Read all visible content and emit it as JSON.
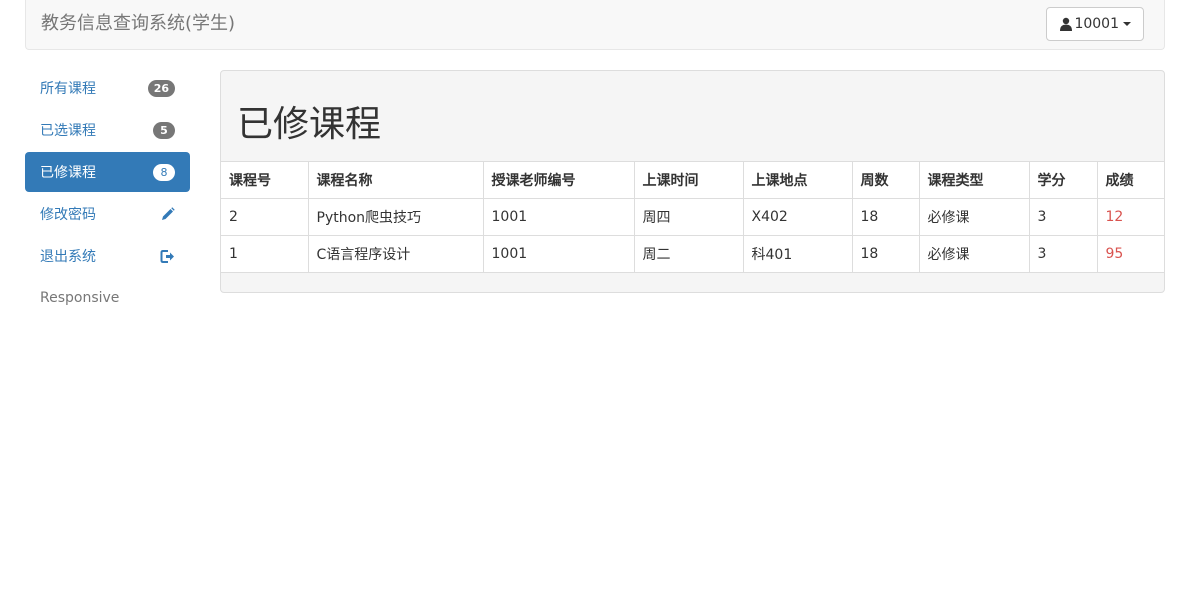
{
  "navbar": {
    "brand": "教务信息查询系统(学生)",
    "user_id": "10001"
  },
  "sidebar": {
    "items": [
      {
        "label": "所有课程",
        "badge": "26",
        "active": false
      },
      {
        "label": "已选课程",
        "badge": "5",
        "active": false
      },
      {
        "label": "已修课程",
        "badge": "8",
        "active": true
      },
      {
        "label": "修改密码",
        "icon": "pencil-icon"
      },
      {
        "label": "退出系统",
        "icon": "logout-icon"
      }
    ],
    "footer": "Responsive"
  },
  "panel": {
    "title": "已修课程",
    "columns": [
      "课程号",
      "课程名称",
      "授课老师编号",
      "上课时间",
      "上课地点",
      "周数",
      "课程类型",
      "学分",
      "成绩"
    ],
    "rows": [
      [
        "2",
        "Python爬虫技巧",
        "1001",
        "周四",
        "X402",
        "18",
        "必修课",
        "3",
        "12"
      ],
      [
        "1",
        "C语言程序设计",
        "1001",
        "周二",
        "科401",
        "18",
        "必修课",
        "3",
        "95"
      ]
    ]
  },
  "colors": {
    "accent": "#337ab7",
    "score": "#d9534f",
    "badge": "#777777"
  }
}
